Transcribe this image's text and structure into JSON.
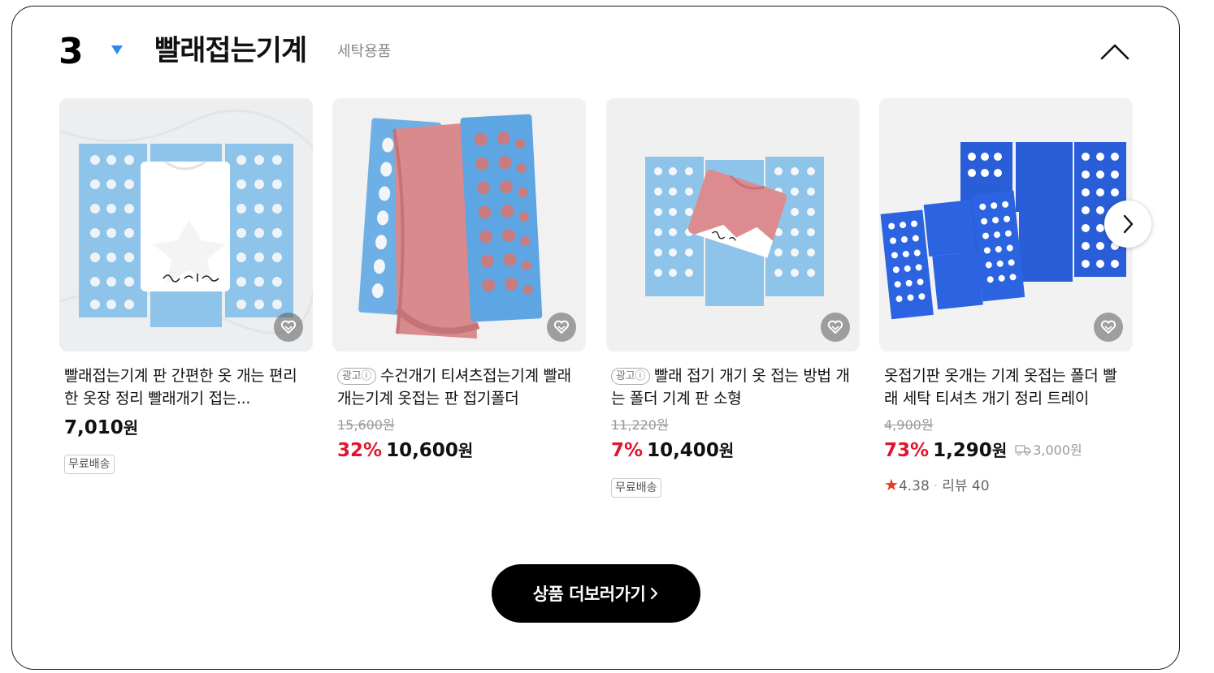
{
  "header": {
    "rank": "3",
    "rank_change_icon": "triangle-down-icon",
    "keyword": "빨래접는기계",
    "category": "세탁용품",
    "collapse_icon": "chevron-up-icon"
  },
  "colors": {
    "discount": "#e0152d",
    "rank_change": "#2a8bea",
    "star": "#e63b25"
  },
  "products": [
    {
      "ad_label": "",
      "title": "빨래접는기계 판 간편한 옷 개는 편리한 옷장 정리 빨래개기 접는...",
      "original_price": "",
      "discount": "",
      "price": "7,010",
      "won": "원",
      "shipping_fee": "",
      "free_shipping": "무료배송",
      "rating": "",
      "review_label": "",
      "reviews": ""
    },
    {
      "ad_label": "광고ⓘ",
      "title": "수건개기 티셔츠접는기계 빨래개는기계 옷접는 판 접기폴더",
      "original_price": "15,600원",
      "discount": "32%",
      "price": "10,600",
      "won": "원",
      "shipping_fee": "",
      "free_shipping": "",
      "rating": "",
      "review_label": "",
      "reviews": ""
    },
    {
      "ad_label": "광고ⓘ",
      "title": "빨래 접기 개기 옷 접는 방법 개는 폴더 기계 판 소형",
      "original_price": "11,220원",
      "discount": "7%",
      "price": "10,400",
      "won": "원",
      "shipping_fee": "",
      "free_shipping": "무료배송",
      "rating": "",
      "review_label": "",
      "reviews": ""
    },
    {
      "ad_label": "",
      "title": "옷접기판 옷개는 기계 옷접는 폴더 빨래 세탁 티셔츠 개기 정리 트레이",
      "original_price": "4,900원",
      "discount": "73%",
      "price": "1,290",
      "won": "원",
      "shipping_fee": "3,000원",
      "free_shipping": "",
      "rating": "4.38",
      "review_label": "리뷰",
      "reviews": "40"
    }
  ],
  "icons": {
    "wish": "heart-icon",
    "next": "chevron-right-icon",
    "shipping": "truck-icon"
  },
  "more_button": {
    "label": "상품 더보러가기"
  }
}
